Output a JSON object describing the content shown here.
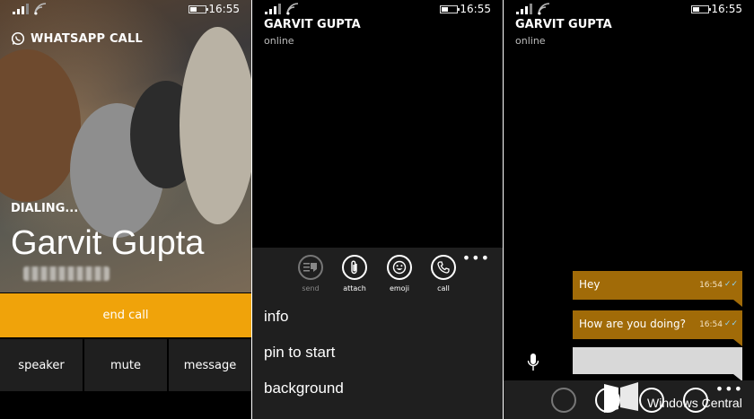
{
  "status_bar": {
    "time": "16:55"
  },
  "call_screen": {
    "title": "WHATSAPP CALL",
    "status": "DIALING...",
    "caller_name": "Garvit Gupta",
    "end_call_label": "end call",
    "buttons": [
      "speaker",
      "mute",
      "message"
    ],
    "accent_color": "#f0a30a"
  },
  "chat_menu_screen": {
    "contact_name": "GARVIT GUPTA",
    "contact_status": "online",
    "appbar_buttons": [
      {
        "label": "send",
        "icon": "send-icon",
        "enabled": false
      },
      {
        "label": "attach",
        "icon": "paperclip-icon",
        "enabled": true
      },
      {
        "label": "emoji",
        "icon": "emoji-icon",
        "enabled": true
      },
      {
        "label": "call",
        "icon": "phone-icon",
        "enabled": true
      }
    ],
    "menu_items": [
      "info",
      "pin to start",
      "background"
    ],
    "more_label": "•••"
  },
  "chat_screen": {
    "contact_name": "GARVIT GUPTA",
    "contact_status": "online",
    "messages": [
      {
        "text": "Hey",
        "time": "16:54",
        "ticks": "✓✓"
      },
      {
        "text": "How are you doing?",
        "time": "16:54",
        "ticks": "✓✓"
      }
    ],
    "bubble_color": "#a16b08",
    "more_label": "•••",
    "watermark": "Windows Central"
  }
}
